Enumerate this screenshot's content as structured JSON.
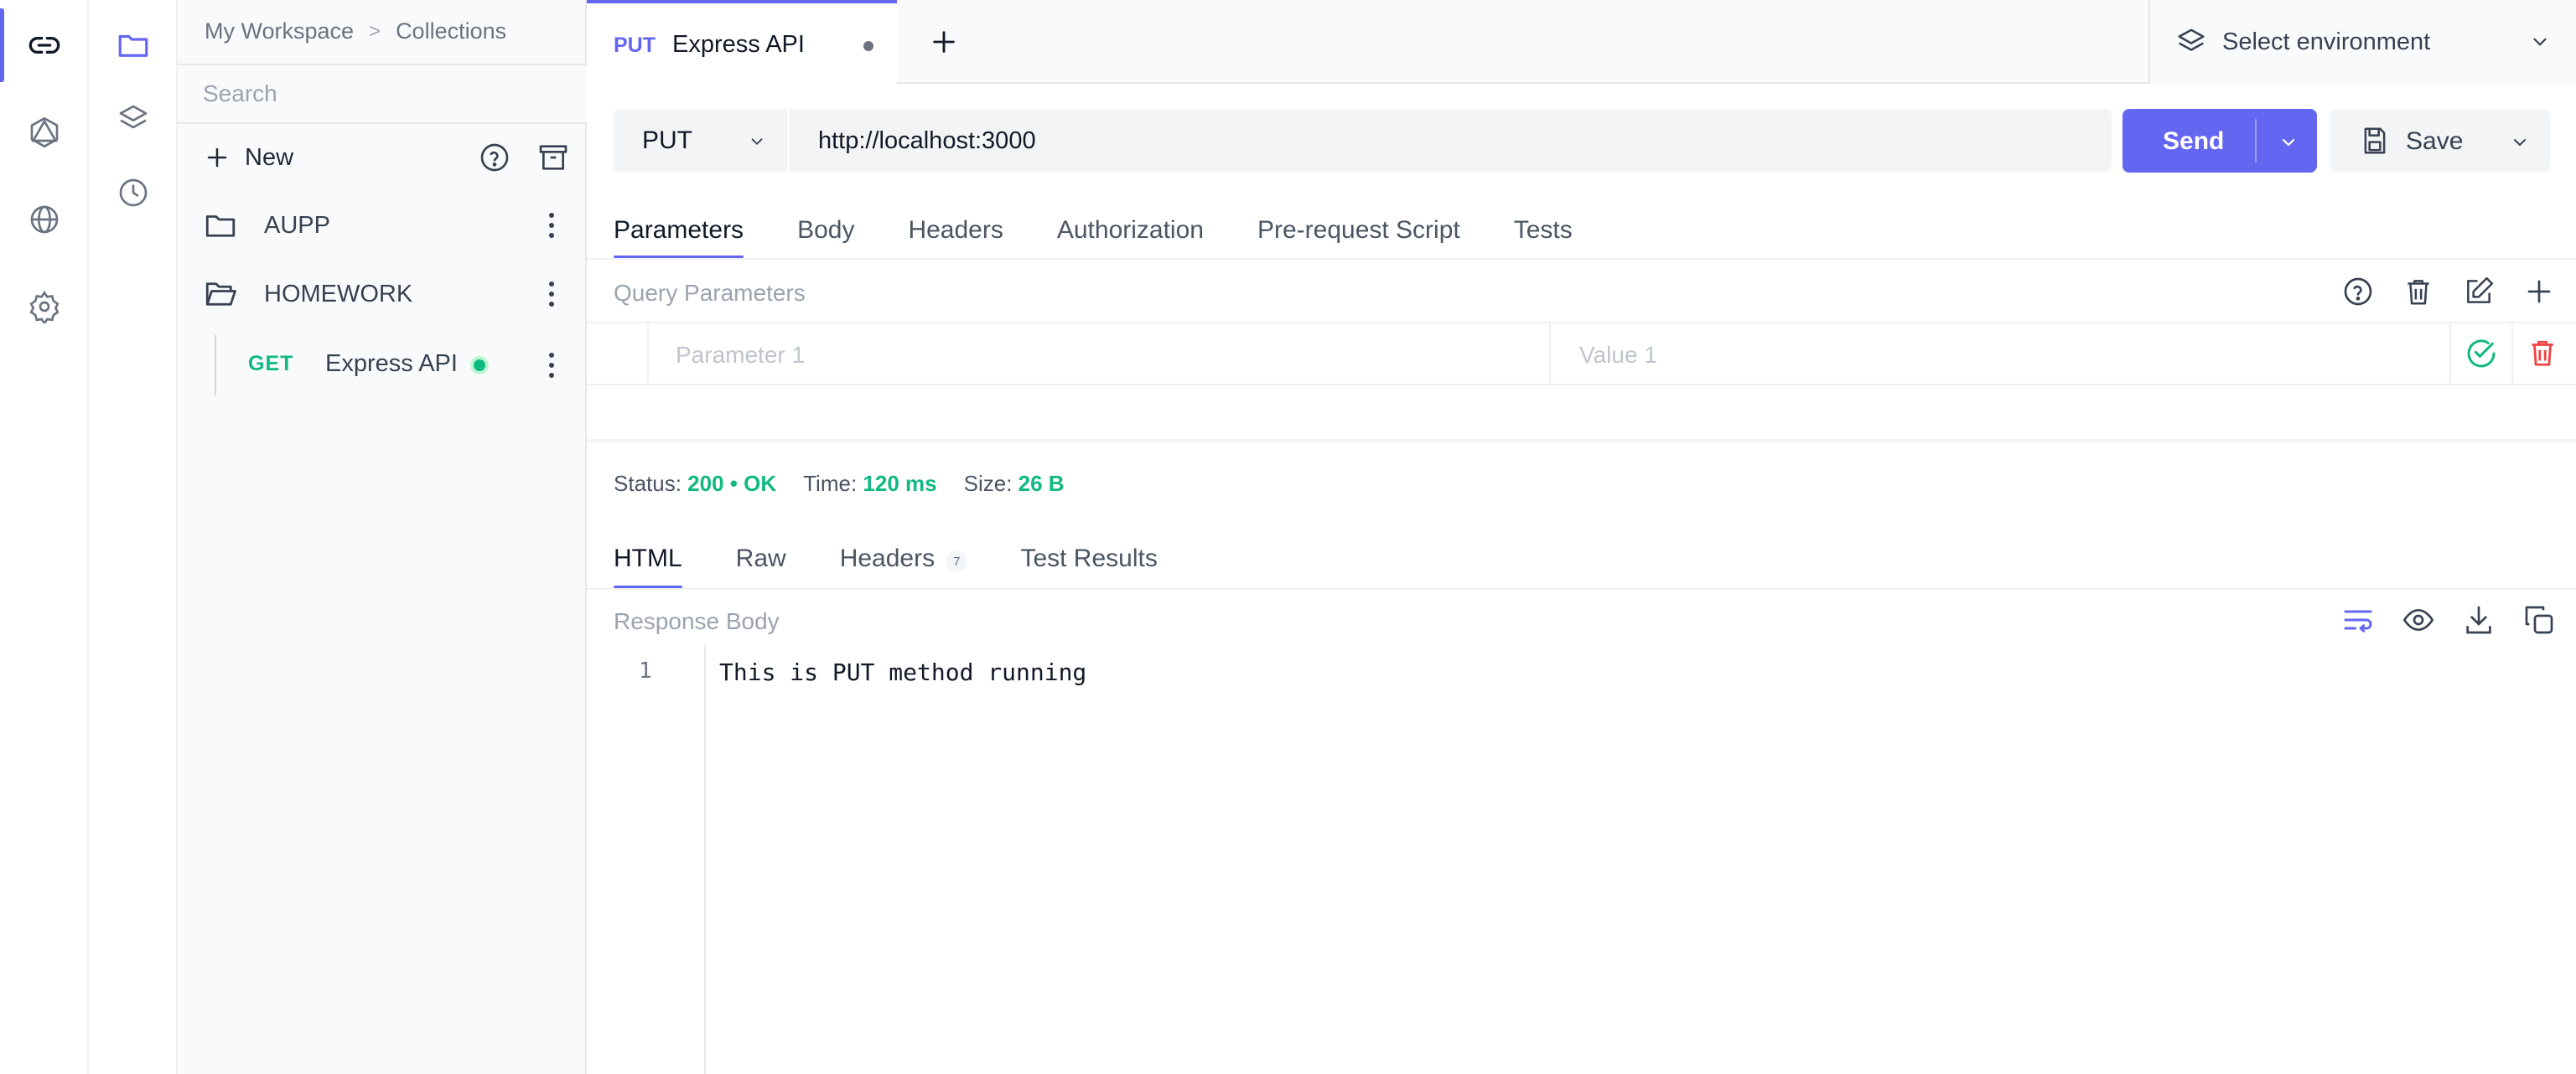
{
  "rail": {
    "items": [
      {
        "icon": "link-icon",
        "active": true
      },
      {
        "icon": "graphql-icon"
      },
      {
        "icon": "globe-icon"
      },
      {
        "icon": "settings-icon"
      }
    ]
  },
  "rail2": {
    "items": [
      {
        "icon": "folder-icon",
        "active": true
      },
      {
        "icon": "layers-icon"
      },
      {
        "icon": "history-icon"
      }
    ]
  },
  "sidebar": {
    "breadcrumb": [
      "My Workspace",
      ">",
      "Collections"
    ],
    "search_placeholder": "Search",
    "new_label": "New",
    "collections": [
      {
        "label": "AUPP",
        "icon": "folder-icon"
      },
      {
        "label": "HOMEWORK",
        "icon": "folder-open-icon"
      }
    ],
    "request": {
      "method": "GET",
      "name": "Express API"
    }
  },
  "tabs": [
    {
      "method": "PUT",
      "name": "Express API",
      "unsaved": true
    }
  ],
  "environment": {
    "label": "Select environment"
  },
  "request": {
    "method": "PUT",
    "url": "http://localhost:3000",
    "send_label": "Send",
    "save_label": "Save",
    "tabs": [
      "Parameters",
      "Body",
      "Headers",
      "Authorization",
      "Pre-request Script",
      "Tests"
    ],
    "active_tab": "Parameters",
    "query_title": "Query Parameters",
    "param_key_placeholder": "Parameter 1",
    "param_value_placeholder": "Value 1"
  },
  "response": {
    "status_label": "Status:",
    "status_code": "200",
    "status_text": "OK",
    "time_label": "Time:",
    "time_value": "120 ms",
    "size_label": "Size:",
    "size_value": "26 B",
    "tabs": [
      "HTML",
      "Raw",
      "Headers",
      "Test Results"
    ],
    "headers_count": "7",
    "body_title": "Response Body",
    "line_number": "1",
    "body": "This is PUT method running"
  },
  "colors": {
    "accent": "#6366f1",
    "success": "#10b981",
    "danger": "#ef4444"
  }
}
